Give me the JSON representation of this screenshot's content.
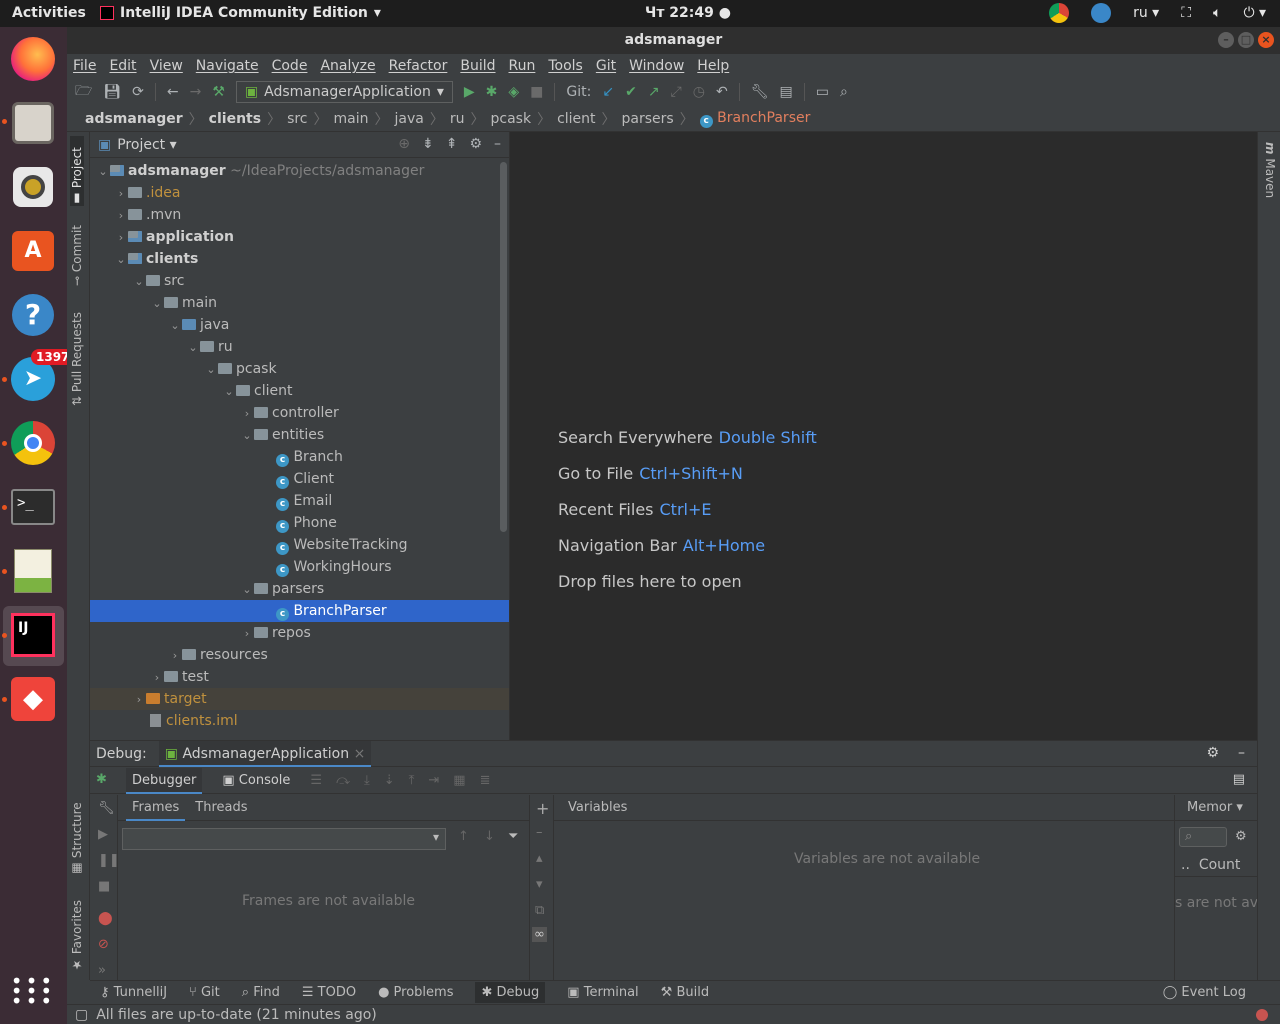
{
  "topbar": {
    "activities": "Activities",
    "app_name": "IntelliJ IDEA Community Edition",
    "clock": "Чт 22:49",
    "language": "ru"
  },
  "dock": {
    "telegram_badge": "1397"
  },
  "window": {
    "title": "adsmanager"
  },
  "menu": [
    "File",
    "Edit",
    "View",
    "Navigate",
    "Code",
    "Analyze",
    "Refactor",
    "Build",
    "Run",
    "Tools",
    "Git",
    "Window",
    "Help"
  ],
  "toolbar": {
    "run_config": "AdsmanagerApplication",
    "git_label": "Git:"
  },
  "breadcrumb": [
    "adsmanager",
    "clients",
    "src",
    "main",
    "java",
    "ru",
    "pcask",
    "client",
    "parsers",
    "BranchParser"
  ],
  "project": {
    "title": "Project",
    "root_name": "adsmanager",
    "root_path": "~/IdeaProjects/adsmanager",
    "tree": [
      {
        "label": "adsmanager",
        "extra": "~/IdeaProjects/adsmanager"
      },
      {
        "label": ".idea"
      },
      {
        "label": ".mvn"
      },
      {
        "label": "application"
      },
      {
        "label": "clients"
      },
      {
        "label": "src"
      },
      {
        "label": "main"
      },
      {
        "label": "java"
      },
      {
        "label": "ru"
      },
      {
        "label": "pcask"
      },
      {
        "label": "client"
      },
      {
        "label": "controller"
      },
      {
        "label": "entities"
      },
      {
        "label": "Branch"
      },
      {
        "label": "Client"
      },
      {
        "label": "Email"
      },
      {
        "label": "Phone"
      },
      {
        "label": "WebsiteTracking"
      },
      {
        "label": "WorkingHours"
      },
      {
        "label": "parsers"
      },
      {
        "label": "BranchParser"
      },
      {
        "label": "repos"
      },
      {
        "label": "resources"
      },
      {
        "label": "test"
      },
      {
        "label": "target"
      },
      {
        "label": "clients.iml"
      }
    ]
  },
  "stripes": {
    "left": [
      "Project",
      "Commit",
      "Pull Requests",
      "Structure",
      "Favorites"
    ],
    "right": [
      "Maven"
    ]
  },
  "editor_hints": [
    {
      "label": "Search Everywhere",
      "key": "Double Shift"
    },
    {
      "label": "Go to File",
      "key": "Ctrl+Shift+N"
    },
    {
      "label": "Recent Files",
      "key": "Ctrl+E"
    },
    {
      "label": "Navigation Bar",
      "key": "Alt+Home"
    },
    {
      "label": "Drop files here to open",
      "key": ""
    }
  ],
  "debug": {
    "title": "Debug:",
    "session": "AdsmanagerApplication",
    "tabs": [
      "Debugger",
      "Console"
    ],
    "frame_tabs": [
      "Frames",
      "Threads"
    ],
    "frames_empty": "Frames are not available",
    "variables_title": "Variables",
    "variables_empty": "Variables are not available",
    "memory_title": "Memor",
    "memory_count": "Count",
    "memory_empty": "s are not av"
  },
  "bottom_tools": [
    "TunnelliJ",
    "Git",
    "Find",
    "TODO",
    "Problems",
    "Debug",
    "Terminal",
    "Build"
  ],
  "event_log": "Event Log",
  "status": "All files are up-to-date (21 minutes ago)"
}
